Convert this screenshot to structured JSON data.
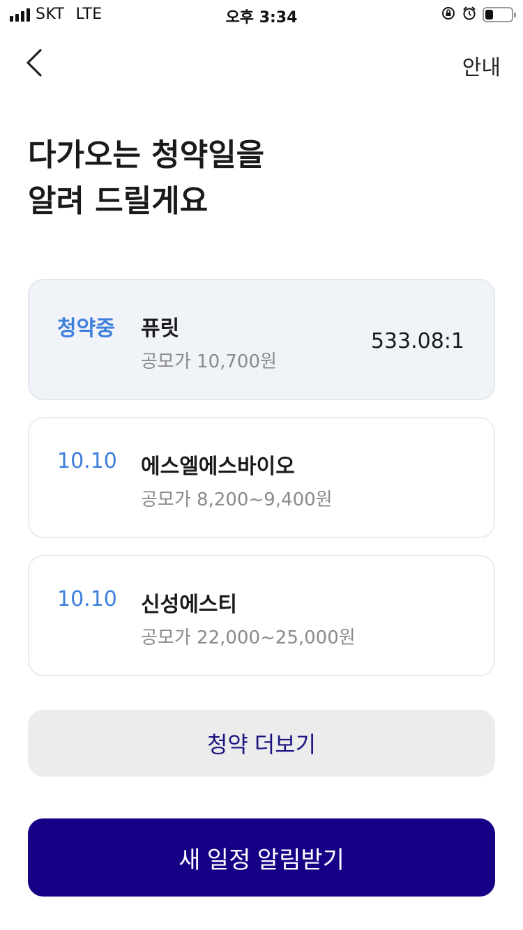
{
  "status_bar": {
    "carrier": "SKT",
    "network": "LTE",
    "time": "오후 3:34",
    "battery_level": 0.3
  },
  "nav": {
    "back_icon": "chevron-left-icon",
    "info_label": "안내"
  },
  "headline": {
    "line1": "다가오는 청약일을",
    "line2": "알려 드릴게요"
  },
  "ipo_list": [
    {
      "tag": "청약중",
      "name": "퓨릿",
      "price": "공모가 10,700원",
      "rate": "533.08:1"
    },
    {
      "tag": "10.10",
      "name": "에스엘에스바이오",
      "price": "공모가 8,200~9,400원"
    },
    {
      "tag": "10.10",
      "name": "신성에스티",
      "price": "공모가 22,000~25,000원"
    }
  ],
  "buttons": {
    "more_label": "청약 더보기",
    "primary_label": "새 일정 알림받기"
  },
  "colors": {
    "accent_blue": "#3d7fdc",
    "primary_navy": "#160086",
    "active_card_bg": "#f0f3f8"
  }
}
